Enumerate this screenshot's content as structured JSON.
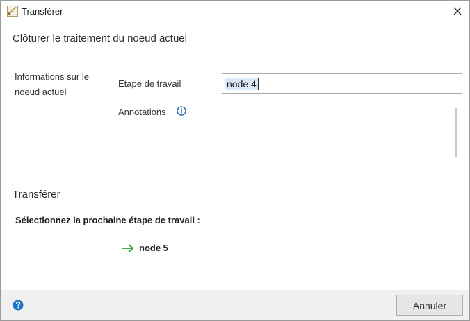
{
  "window": {
    "title": "Transférer",
    "icon": "app-icon",
    "close_icon": "close-icon"
  },
  "heading": "Clôturer le traitement du noeud actuel",
  "current_node": {
    "section_label": "Informations sur le noeud actuel",
    "step_label": "Etape de travail",
    "step_value": "node 4",
    "annotations_label": "Annotations",
    "annotations_value": "",
    "info_icon": "info-icon"
  },
  "transfer": {
    "heading": "Transférer",
    "prompt": "Sélectionnez la prochaine étape de travail :",
    "next_steps": [
      {
        "label": "node 5",
        "icon": "arrow-right-icon"
      }
    ]
  },
  "footer": {
    "help_icon": "help-icon",
    "cancel_label": "Annuler"
  },
  "colors": {
    "accent_green": "#2e9a3a",
    "help_blue": "#1a73c9",
    "footer_bg": "#f0f0f0",
    "selection": "#dbe8f6"
  }
}
